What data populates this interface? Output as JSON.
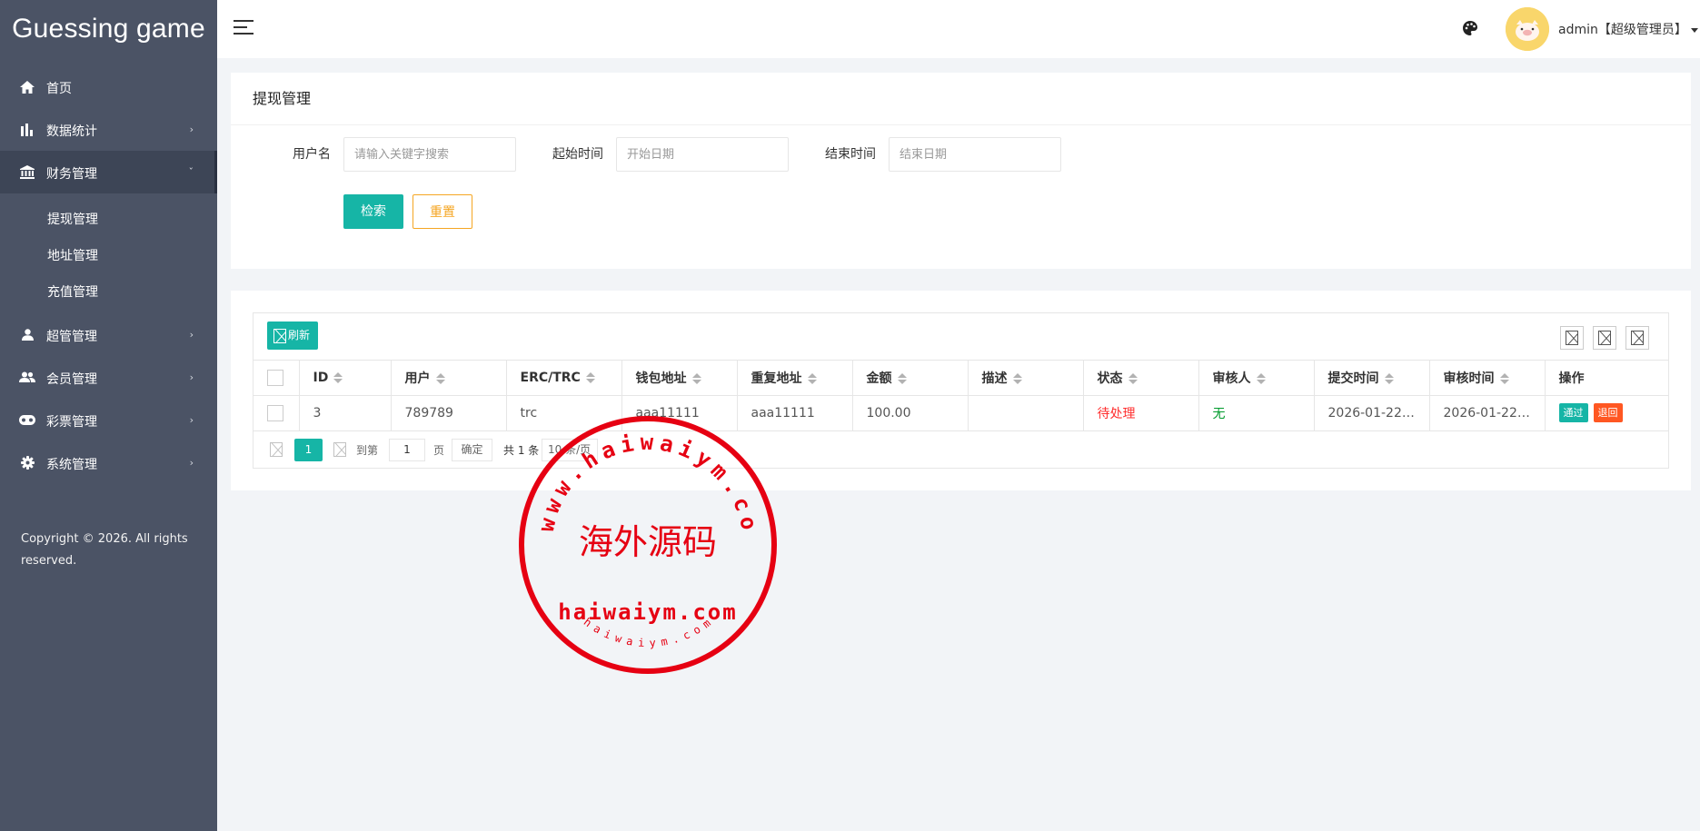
{
  "app": {
    "brand": "Guessing game"
  },
  "sidebar": {
    "items": [
      {
        "label": "首页",
        "icon": "home-icon"
      },
      {
        "label": "数据统计",
        "icon": "bar-chart-icon"
      },
      {
        "label": "财务管理",
        "icon": "bank-icon",
        "expanded": true,
        "children": [
          {
            "label": "提现管理"
          },
          {
            "label": "地址管理"
          },
          {
            "label": "充值管理"
          }
        ]
      },
      {
        "label": "超管管理",
        "icon": "user-icon"
      },
      {
        "label": "会员管理",
        "icon": "users-icon"
      },
      {
        "label": "彩票管理",
        "icon": "gamepad-icon"
      },
      {
        "label": "系统管理",
        "icon": "gear-icon"
      }
    ],
    "copyright": "Copyright © 2026. All rights reserved."
  },
  "header": {
    "user_label": "admin【超级管理员】"
  },
  "search": {
    "title": "提现管理",
    "username_label": "用户名",
    "username_placeholder": "请输入关键字搜索",
    "start_label": "起始时间",
    "start_placeholder": "开始日期",
    "end_label": "结束时间",
    "end_placeholder": "结束日期",
    "search_button": "检索",
    "reset_button": "重置"
  },
  "table": {
    "refresh_button": "刷新",
    "columns": [
      "ID",
      "用户",
      "ERC/TRC",
      "钱包地址",
      "重复地址",
      "金额",
      "描述",
      "状态",
      "审核人",
      "提交时间",
      "审核时间",
      "操作"
    ],
    "rows": [
      {
        "id": "3",
        "user": "789789",
        "type": "trc",
        "wallet": "aaa11111",
        "dup": "aaa11111",
        "amount": "100.00",
        "desc": "",
        "status": "待处理",
        "reviewer": "无",
        "submit_time": "2026-01-22 ...",
        "review_time": "2026-01-22 ...",
        "pass_label": "通过",
        "back_label": "退回"
      }
    ],
    "pager": {
      "current_page": "1",
      "goto_label": "到第",
      "goto_value": "1",
      "page_unit": "页",
      "confirm": "确定",
      "total": "共 1 条",
      "page_size": "10 条/页"
    }
  },
  "stamp": {
    "ring_text": "www.haiwaiym.com",
    "center_text": "海外源码",
    "domain_text": "haiwaiym.com",
    "bottom_text": "haiwaiym.com"
  },
  "colors": {
    "sidebar": "#4b5365",
    "accent": "#16b5a6",
    "warning": "#f5a623",
    "danger": "#ff5722",
    "stamp": "#e60012"
  }
}
